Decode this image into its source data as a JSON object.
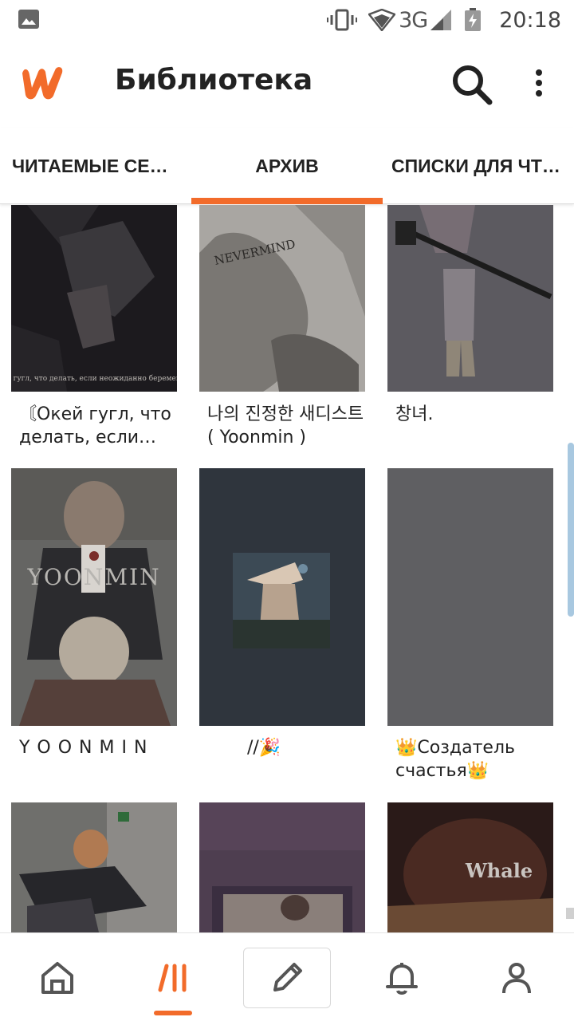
{
  "status_bar": {
    "network": "3G",
    "time": "20:18",
    "icons": [
      "gallery-icon",
      "vibrate-icon",
      "wifi-icon",
      "signal-icon",
      "battery-icon"
    ]
  },
  "app_bar": {
    "title": "Библиотека",
    "icons": [
      "wattpad-logo",
      "search-icon",
      "more-vert-icon"
    ]
  },
  "tabs": [
    {
      "label": "ЧИТАЕМЫЕ СЕЙЧАС"
    },
    {
      "label": "АРХИВ",
      "selected": true
    },
    {
      "label": "СПИСКИ ДЛЯ ЧТЕНИЯ"
    }
  ],
  "stories": [
    {
      "title": "〘Окей гугл, что делать, если не...",
      "cover_text": "Окей гугл, что делать, если неожиданно беременна(?"
    },
    {
      "title": "나의 진정한 새디스트 ( Yoonmin )",
      "cover_text": "NEVERMIND"
    },
    {
      "title": "창녀."
    },
    {
      "title": "Y O O N M I N",
      "cover_text": "YOONMIN"
    },
    {
      "title": "//🎉"
    },
    {
      "title": "👑Создатель счастья👑"
    },
    {
      "title": ""
    },
    {
      "title": ""
    },
    {
      "title": "",
      "cover_text": "Whale"
    }
  ],
  "bottom_nav": {
    "items": [
      "home-icon",
      "library-icon",
      "write-icon",
      "notifications-icon",
      "profile-icon"
    ],
    "active": "library-icon"
  },
  "colors": {
    "accent": "#f26b2a",
    "text": "#222222",
    "scrollbar": "#a8c8e0"
  }
}
